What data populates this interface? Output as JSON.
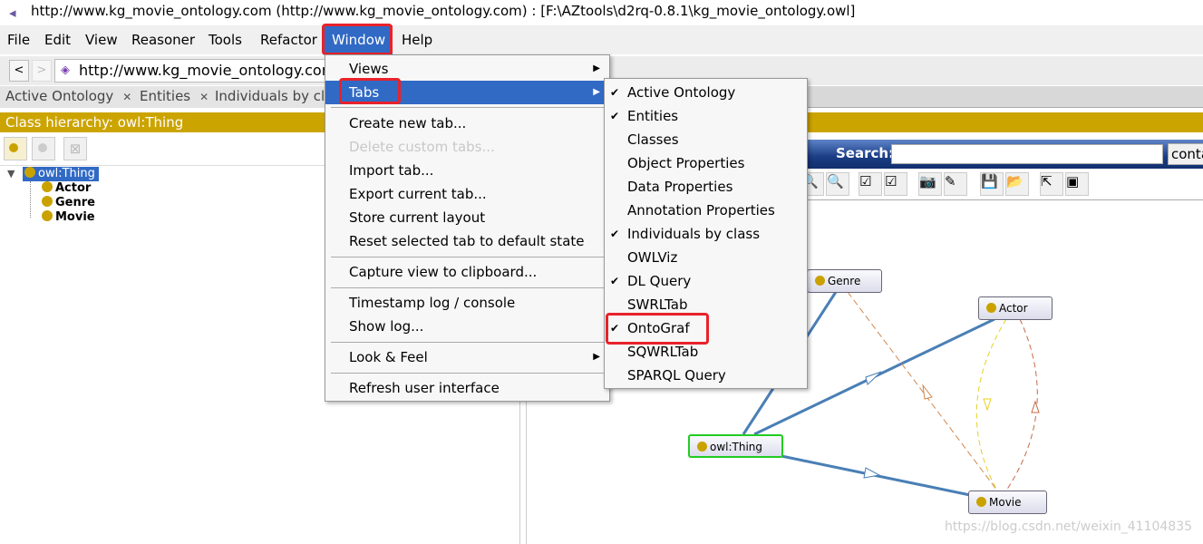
{
  "window": {
    "title": "http://www.kg_movie_ontology.com (http://www.kg_movie_ontology.com)  : [F:\\AZtools\\d2rq-0.8.1\\kg_movie_ontology.owl]"
  },
  "menubar": [
    "File",
    "Edit",
    "View",
    "Reasoner",
    "Tools",
    "Refactor",
    "Window",
    "Help"
  ],
  "address": {
    "back": "<",
    "forward": ">",
    "iri": "http://www.kg_movie_ontology.com"
  },
  "tabs": [
    "Active Ontology",
    "Entities",
    "Individuals by cla"
  ],
  "left": {
    "header": "Class hierarchy: owl:Thing",
    "tree": {
      "root": "owl:Thing",
      "children": [
        "Actor",
        "Genre",
        "Movie"
      ]
    }
  },
  "right": {
    "search_label": "Search:",
    "search_value": "",
    "search_mode": "conta"
  },
  "window_menu": [
    {
      "label": "Views",
      "submenu": true
    },
    {
      "label": "Tabs",
      "submenu": true,
      "highlighted": true
    },
    {
      "label": "Create new tab..."
    },
    {
      "label": "Delete custom tabs...",
      "disabled": true
    },
    {
      "label": "Import tab..."
    },
    {
      "label": "Export current tab..."
    },
    {
      "label": "Store current layout"
    },
    {
      "label": "Reset selected tab to default state"
    },
    {
      "label": "Capture view to clipboard..."
    },
    {
      "label": "Timestamp log / console"
    },
    {
      "label": "Show log..."
    },
    {
      "label": "Look & Feel",
      "submenu": true
    },
    {
      "label": "Refresh user interface"
    }
  ],
  "tabs_submenu": [
    {
      "label": "Active Ontology",
      "checked": true
    },
    {
      "label": "Entities",
      "checked": true
    },
    {
      "label": "Classes",
      "checked": false
    },
    {
      "label": "Object Properties",
      "checked": false
    },
    {
      "label": "Data Properties",
      "checked": false
    },
    {
      "label": "Annotation Properties",
      "checked": false
    },
    {
      "label": "Individuals by class",
      "checked": true
    },
    {
      "label": "OWLViz",
      "checked": false
    },
    {
      "label": "DL Query",
      "checked": true
    },
    {
      "label": "SWRLTab",
      "checked": false
    },
    {
      "label": "OntoGraf",
      "checked": true
    },
    {
      "label": "SQWRLTab",
      "checked": false
    },
    {
      "label": "SPARQL Query",
      "checked": false
    }
  ],
  "graph": {
    "nodes": [
      "Genre",
      "Actor",
      "owl:Thing",
      "Movie"
    ]
  },
  "watermark": "https://blog.csdn.net/weixin_41104835",
  "colors": {
    "accent": "#316ac5",
    "header": "#cca400",
    "highlight": "#e8222a"
  }
}
